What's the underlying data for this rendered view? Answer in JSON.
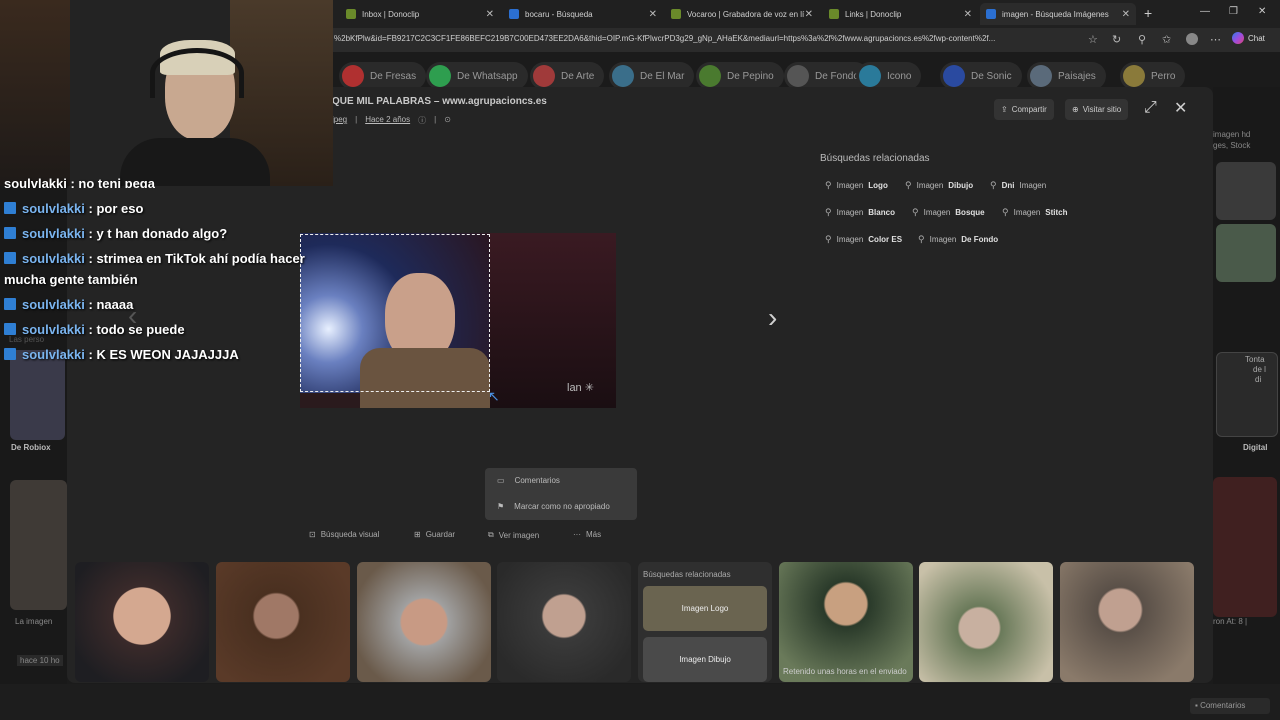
{
  "browser": {
    "tabs": [
      {
        "label": "Inbox | Donoclip",
        "icon": "donoclip-icon"
      },
      {
        "label": "bocaru - Búsqueda",
        "icon": "search-icon"
      },
      {
        "label": "Vocaroo | Grabadora de voz en lí",
        "icon": "vocaroo-icon"
      },
      {
        "label": "Links | Donoclip",
        "icon": "donoclip-icon"
      },
      {
        "label": "imagen - Búsqueda Imágenes",
        "icon": "search-icon"
      }
    ],
    "url": "%2bKfPlw&id=FB9217C2C3CF1FE86BEFC219B7C00ED473EE2DA6&thid=OIP.mG-KfPlwcrPD3g29_gNp_AHaEK&mediaurl=https%3a%2f%2fwww.agrupacioncs.es%2fwp-content%2f...",
    "chat_label": "Chat"
  },
  "chips": [
    {
      "label": "De Fresas",
      "color": "#b03030"
    },
    {
      "label": "De Whatsapp",
      "color": "#2e9e4f"
    },
    {
      "label": "De Arte",
      "color": "#a03a3a"
    },
    {
      "label": "De El Mar",
      "color": "#3a6e8a"
    },
    {
      "label": "De Pepino",
      "color": "#4a7a2f"
    },
    {
      "label": "De Fondo",
      "color": "#555555"
    },
    {
      "label": "Icono",
      "color": "#2a7a9a"
    },
    {
      "label": "De Sonic",
      "color": "#2a4aa0"
    },
    {
      "label": "Paisajes",
      "color": "#5a6a7a"
    },
    {
      "label": "Perro",
      "color": "#8a7a3a"
    }
  ],
  "modal": {
    "title": "QUE MIL PALABRAS – www.agrupacioncs.es",
    "format": "jpeg",
    "age": "Hace 2 años",
    "share_label": "Compartir",
    "visit_label": "Visitar sitio",
    "prev_arrow": "‹",
    "next_arrow": "›",
    "related_title": "Búsquedas relacionadas",
    "related": [
      {
        "prefix": "Imagen",
        "term": "Logo"
      },
      {
        "prefix": "Imagen",
        "term": "Dibujo"
      },
      {
        "prefix": "Dni",
        "term": "Imagen",
        "bold_first": true
      },
      {
        "prefix": "Imagen",
        "term": "Blanco"
      },
      {
        "prefix": "Imagen",
        "term": "Bosque"
      },
      {
        "prefix": "Imagen",
        "term": "Stitch"
      },
      {
        "prefix": "Imagen",
        "term": "Color ES"
      },
      {
        "prefix": "Imagen",
        "term": "De Fondo"
      }
    ],
    "image_watermark": "lan"
  },
  "actions": {
    "visual_search": "Búsqueda visual",
    "save": "Guardar",
    "view_image": "Ver imagen",
    "more": "Más",
    "menu": {
      "comments": "Comentarios",
      "report": "Marcar como no apropiado"
    }
  },
  "strip": {
    "related_title": "Búsquedas relacionadas",
    "related_cards": [
      "Imagen Logo",
      "Imagen Dibujo"
    ],
    "retained_text": "Retenido unas horas en el enviado"
  },
  "background": {
    "left_labels": [
      "De Robiox",
      "La imagen",
      "hace 10 ho",
      "Las perso"
    ],
    "right_labels": [
      "imagen hd",
      "ges, Stock",
      "Digital",
      "ron At: 8 |",
      "Tonta",
      "de l",
      "di"
    ],
    "feedback": "Comentarios"
  },
  "chat": {
    "partial_first": "soulvlakki : no teni pega",
    "messages": [
      {
        "user": "soulvlakki",
        "text": ": por eso"
      },
      {
        "user": "soulvlakki",
        "text": ": y t han donado algo?"
      },
      {
        "user": "soulvlakki",
        "text": ": strimea en TikTok ahí podía hacer"
      },
      {
        "user": "soulvlakki",
        "text": ": naaaa"
      },
      {
        "user": "soulvlakki",
        "text": ": todo se puede"
      },
      {
        "user": "soulvlakki",
        "text": ": K ES WEON JAJAJJJA"
      }
    ],
    "wrap_text": "mucha gente también"
  }
}
